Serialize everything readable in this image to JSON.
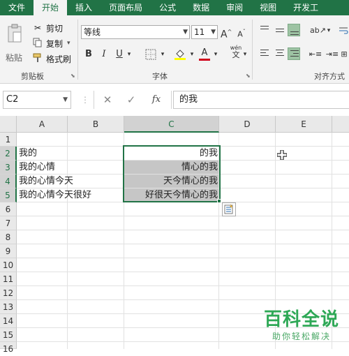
{
  "tabs": [
    {
      "label": "文件",
      "active": false
    },
    {
      "label": "开始",
      "active": true
    },
    {
      "label": "插入",
      "active": false
    },
    {
      "label": "页面布局",
      "active": false
    },
    {
      "label": "公式",
      "active": false
    },
    {
      "label": "数据",
      "active": false
    },
    {
      "label": "审阅",
      "active": false
    },
    {
      "label": "视图",
      "active": false
    },
    {
      "label": "开发工",
      "active": false
    }
  ],
  "ribbon": {
    "clipboard": {
      "paste_label": "粘贴",
      "cut_label": "剪切",
      "copy_label": "复制",
      "format_painter_label": "格式刷",
      "group_label": "剪贴板"
    },
    "font": {
      "font_name": "等线",
      "font_size": "11",
      "bold": "B",
      "italic": "I",
      "underline": "U",
      "grow": "A",
      "shrink": "A",
      "font_color": "A",
      "phonetic": "wén",
      "group_label": "字体"
    },
    "alignment": {
      "group_label": "对齐方式"
    }
  },
  "formula_bar": {
    "name_box": "C2",
    "fx_label": "fx",
    "value": "的我"
  },
  "sheet": {
    "columns": [
      "A",
      "B",
      "C",
      "D",
      "E"
    ],
    "selected_column": "C",
    "rows": [
      "1",
      "2",
      "3",
      "4",
      "5",
      "6",
      "7",
      "8",
      "9",
      "10",
      "11",
      "12",
      "13",
      "14",
      "15",
      "16"
    ],
    "column_a": [
      "",
      "我的",
      "我的心情",
      "我的心情今天",
      "我的心情今天很好"
    ],
    "column_c": [
      "",
      "的我",
      "情心的我",
      "天今情心的我",
      "好很天今情心的我"
    ]
  },
  "watermark": {
    "title": "百科全说",
    "subtitle": "助你轻松解决"
  },
  "colors": {
    "accent": "#217346",
    "highlight": "#c6c6c6"
  }
}
